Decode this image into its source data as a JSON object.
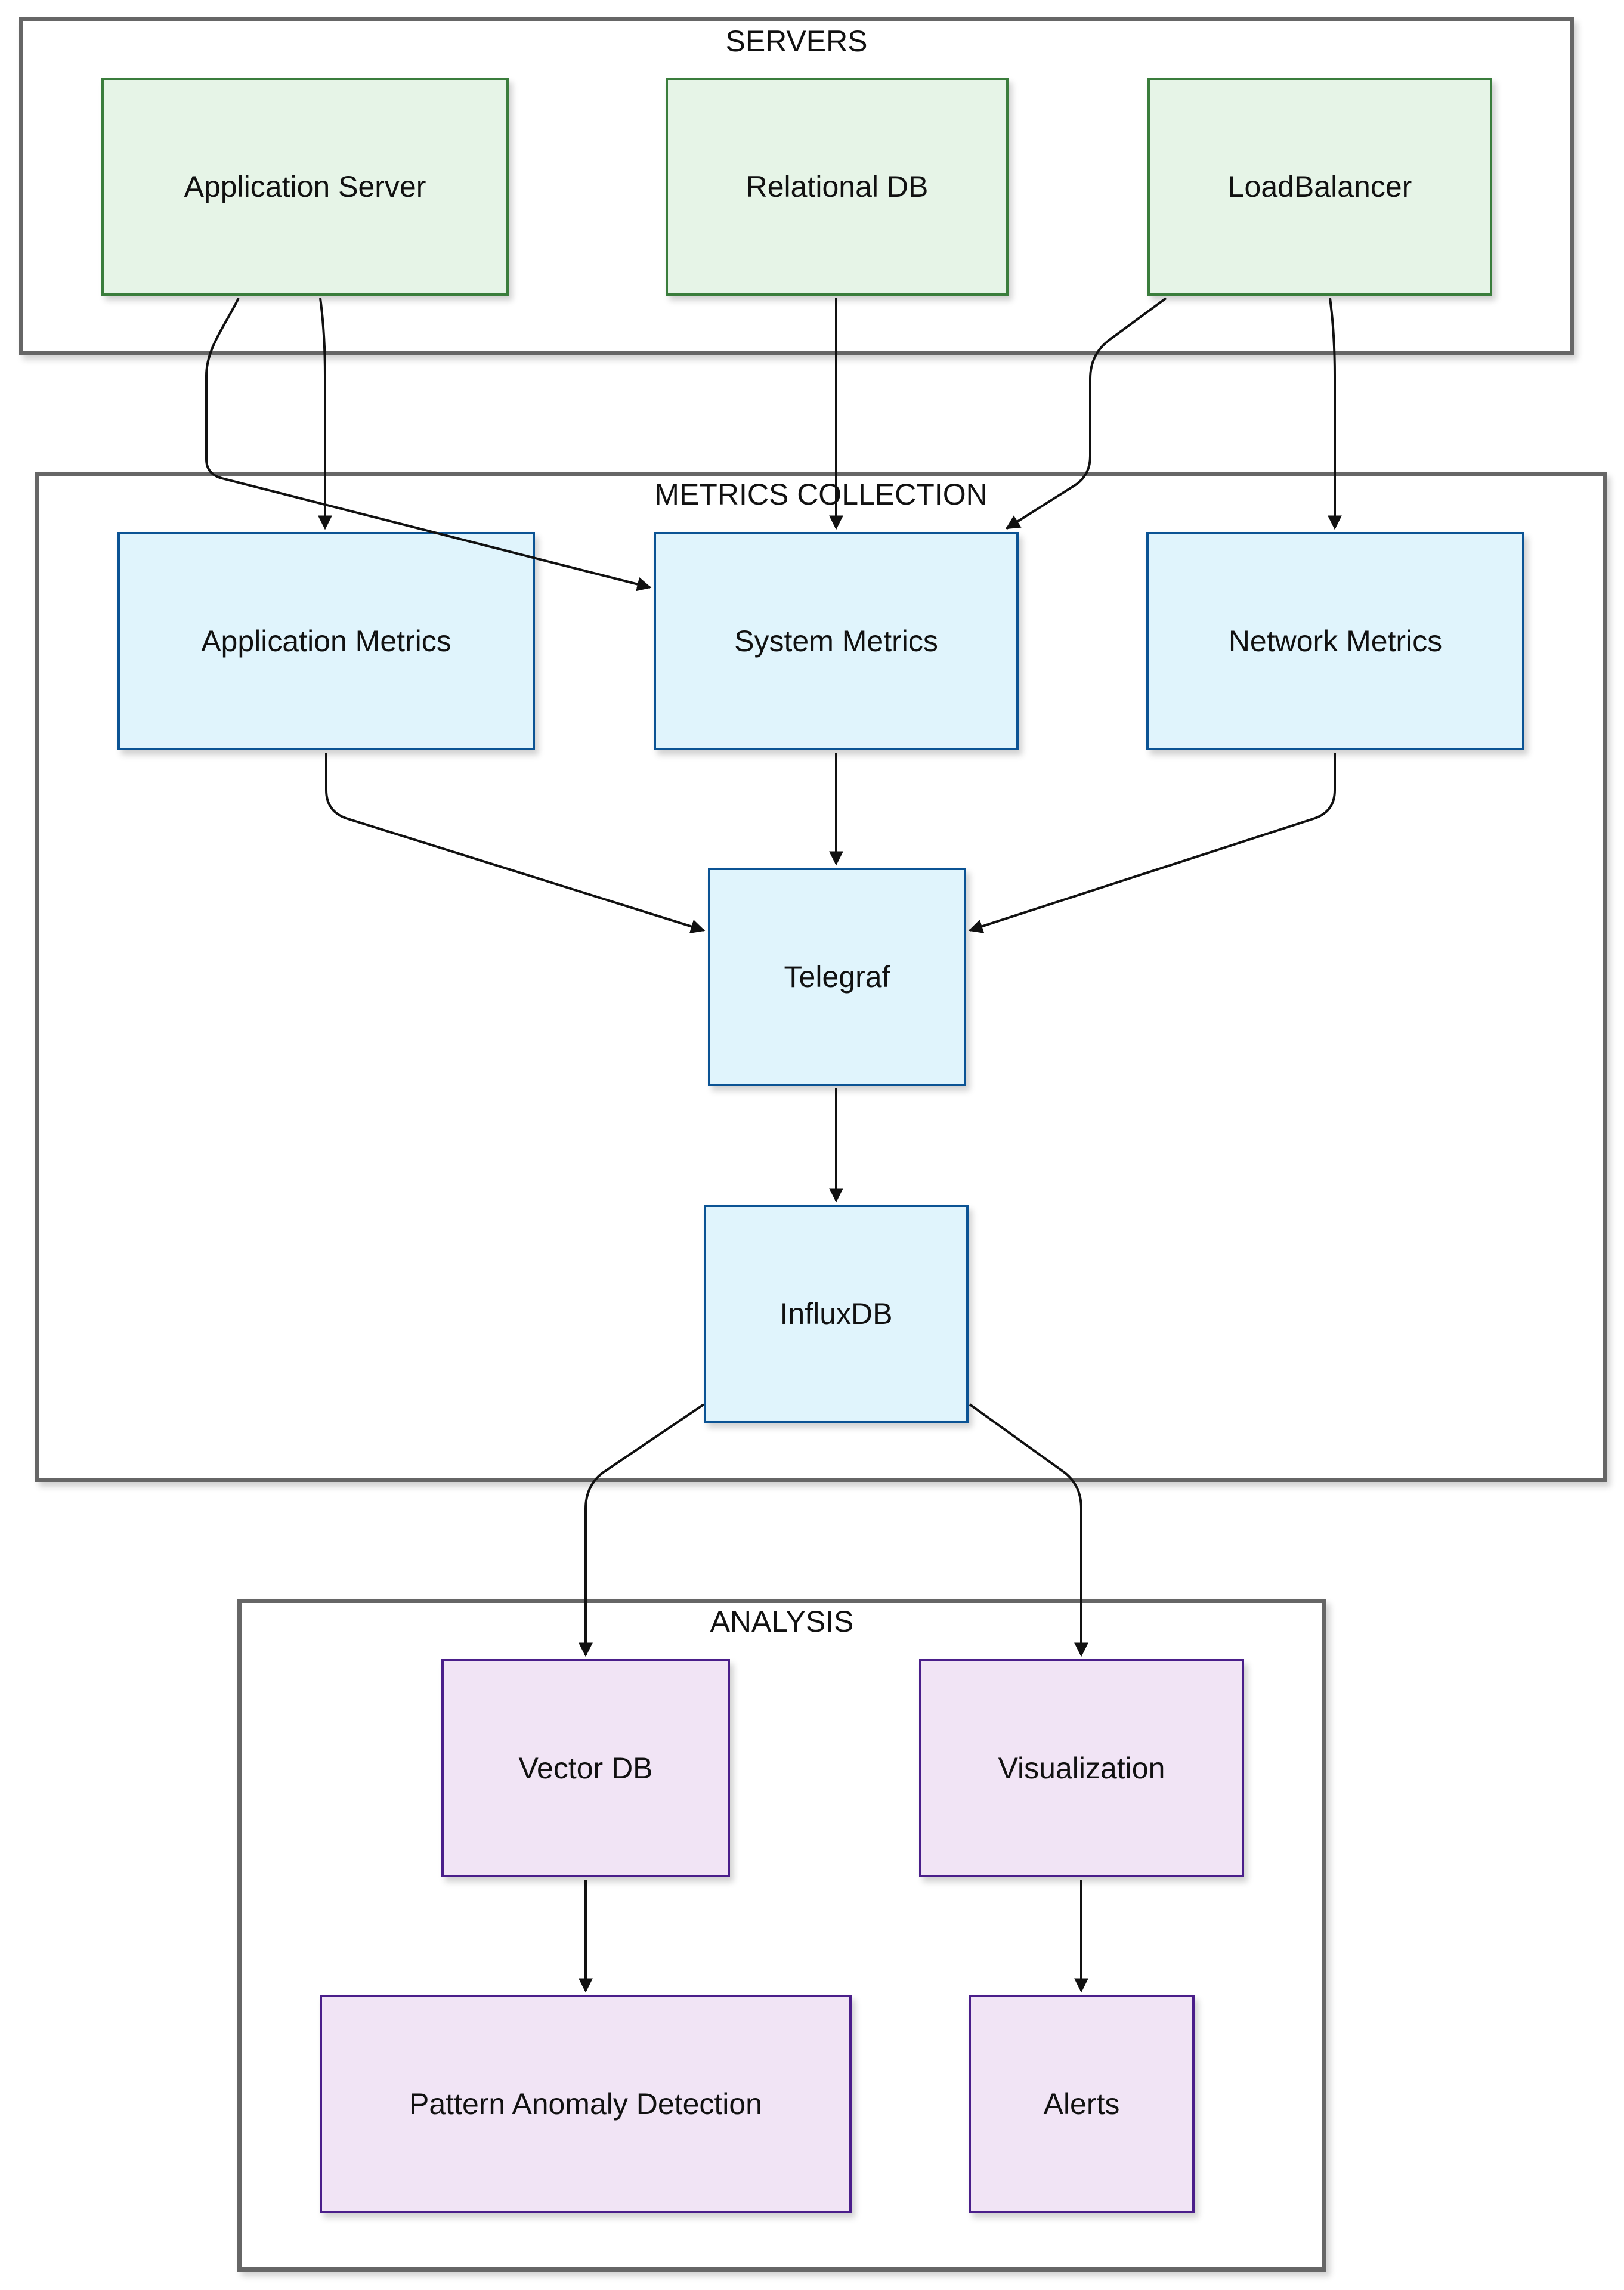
{
  "diagram": {
    "groups": [
      {
        "id": "servers",
        "label": "SERVERS"
      },
      {
        "id": "metrics",
        "label": "METRICS COLLECTION"
      },
      {
        "id": "analysis",
        "label": "ANALYSIS"
      }
    ],
    "nodes": {
      "app_server": {
        "label": "Application Server",
        "group": "servers"
      },
      "relational_db": {
        "label": "Relational DB",
        "group": "servers"
      },
      "load_balancer": {
        "label": "LoadBalancer",
        "group": "servers"
      },
      "app_metrics": {
        "label": "Application Metrics",
        "group": "metrics"
      },
      "system_metrics": {
        "label": "System Metrics",
        "group": "metrics"
      },
      "network_metrics": {
        "label": "Network Metrics",
        "group": "metrics"
      },
      "telegraf": {
        "label": "Telegraf",
        "group": "metrics"
      },
      "influxdb": {
        "label": "InfluxDB",
        "group": "metrics"
      },
      "vector_db": {
        "label": "Vector DB",
        "group": "analysis"
      },
      "visualization": {
        "label": "Visualization",
        "group": "analysis"
      },
      "pattern_anomaly": {
        "label": "Pattern Anomaly Detection",
        "group": "analysis"
      },
      "alerts": {
        "label": "Alerts",
        "group": "analysis"
      }
    },
    "edges": [
      {
        "from": "app_server",
        "to": "app_metrics"
      },
      {
        "from": "app_server",
        "to": "system_metrics"
      },
      {
        "from": "relational_db",
        "to": "system_metrics"
      },
      {
        "from": "load_balancer",
        "to": "system_metrics"
      },
      {
        "from": "load_balancer",
        "to": "network_metrics"
      },
      {
        "from": "app_metrics",
        "to": "telegraf"
      },
      {
        "from": "system_metrics",
        "to": "telegraf"
      },
      {
        "from": "network_metrics",
        "to": "telegraf"
      },
      {
        "from": "telegraf",
        "to": "influxdb"
      },
      {
        "from": "influxdb",
        "to": "vector_db"
      },
      {
        "from": "influxdb",
        "to": "visualization"
      },
      {
        "from": "vector_db",
        "to": "pattern_anomaly"
      },
      {
        "from": "visualization",
        "to": "alerts"
      }
    ],
    "colors": {
      "servers_fill": "#e6f4e7",
      "servers_border": "#3a7d3c",
      "metrics_fill": "#e0f4fc",
      "metrics_border": "#0b5394",
      "analysis_fill": "#f1e4f5",
      "analysis_border": "#4a1e8a",
      "group_border": "#666666",
      "edge": "#111111"
    }
  }
}
